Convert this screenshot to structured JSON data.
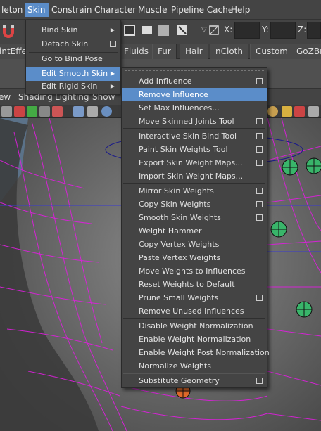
{
  "menubar": {
    "items": [
      "leton",
      "Skin",
      "Constrain",
      "Character",
      "Muscle",
      "Pipeline Cache",
      "Help"
    ]
  },
  "statusline": {
    "x_label": "X:",
    "y_label": "Y:",
    "z_label": "Z:"
  },
  "shelf": {
    "tabs": [
      "intEffe",
      "Fluids",
      "Fur",
      "Hair",
      "nCloth",
      "Custom",
      "GoZBru"
    ]
  },
  "panel_menu": {
    "items": [
      "ew",
      "Shading",
      "Lighting",
      "Show"
    ]
  },
  "skin_menu": {
    "items": [
      {
        "label": "Bind Skin",
        "type": "submenu"
      },
      {
        "label": "Detach Skin",
        "type": "option"
      },
      {
        "label": "Go to Bind Pose",
        "type": "plain"
      },
      {
        "label": "Edit Smooth Skin",
        "type": "submenu",
        "highlighted": true
      },
      {
        "label": "Edit Rigid Skin",
        "type": "submenu"
      }
    ]
  },
  "edit_smooth_skin_menu": {
    "items": [
      {
        "label": "Add Influence",
        "option_box": true
      },
      {
        "label": "Remove Influence",
        "option_box": false,
        "highlighted": true
      },
      {
        "label": "Set Max Influences...",
        "option_box": false
      },
      {
        "label": "Move Skinned Joints Tool",
        "option_box": true
      },
      {
        "label": "Interactive Skin Bind Tool",
        "option_box": true
      },
      {
        "label": "Paint Skin Weights Tool",
        "option_box": true
      },
      {
        "label": "Export Skin Weight Maps...",
        "option_box": true
      },
      {
        "label": "Import Skin Weight Maps...",
        "option_box": false
      },
      {
        "label": "Mirror Skin Weights",
        "option_box": true
      },
      {
        "label": "Copy Skin Weights",
        "option_box": true
      },
      {
        "label": "Smooth Skin Weights",
        "option_box": true
      },
      {
        "label": "Weight Hammer",
        "option_box": false
      },
      {
        "label": "Copy Vertex Weights",
        "option_box": false
      },
      {
        "label": "Paste Vertex Weights",
        "option_box": false
      },
      {
        "label": "Move Weights to Influences",
        "option_box": false
      },
      {
        "label": "Reset Weights to Default",
        "option_box": false
      },
      {
        "label": "Prune Small Weights",
        "option_box": true
      },
      {
        "label": "Remove Unused Influences",
        "option_box": false
      },
      {
        "label": "Disable Weight Normalization",
        "option_box": false
      },
      {
        "label": "Enable Weight Normalization",
        "option_box": false
      },
      {
        "label": "Enable Weight Post Normalization",
        "option_box": false
      },
      {
        "label": "Normalize Weights",
        "option_box": false
      },
      {
        "label": "Substitute Geometry",
        "option_box": true
      }
    ]
  },
  "colors": {
    "highlight": "#5b8dc9",
    "wireframe": "#e01ee0",
    "joint": "#39b56a"
  }
}
